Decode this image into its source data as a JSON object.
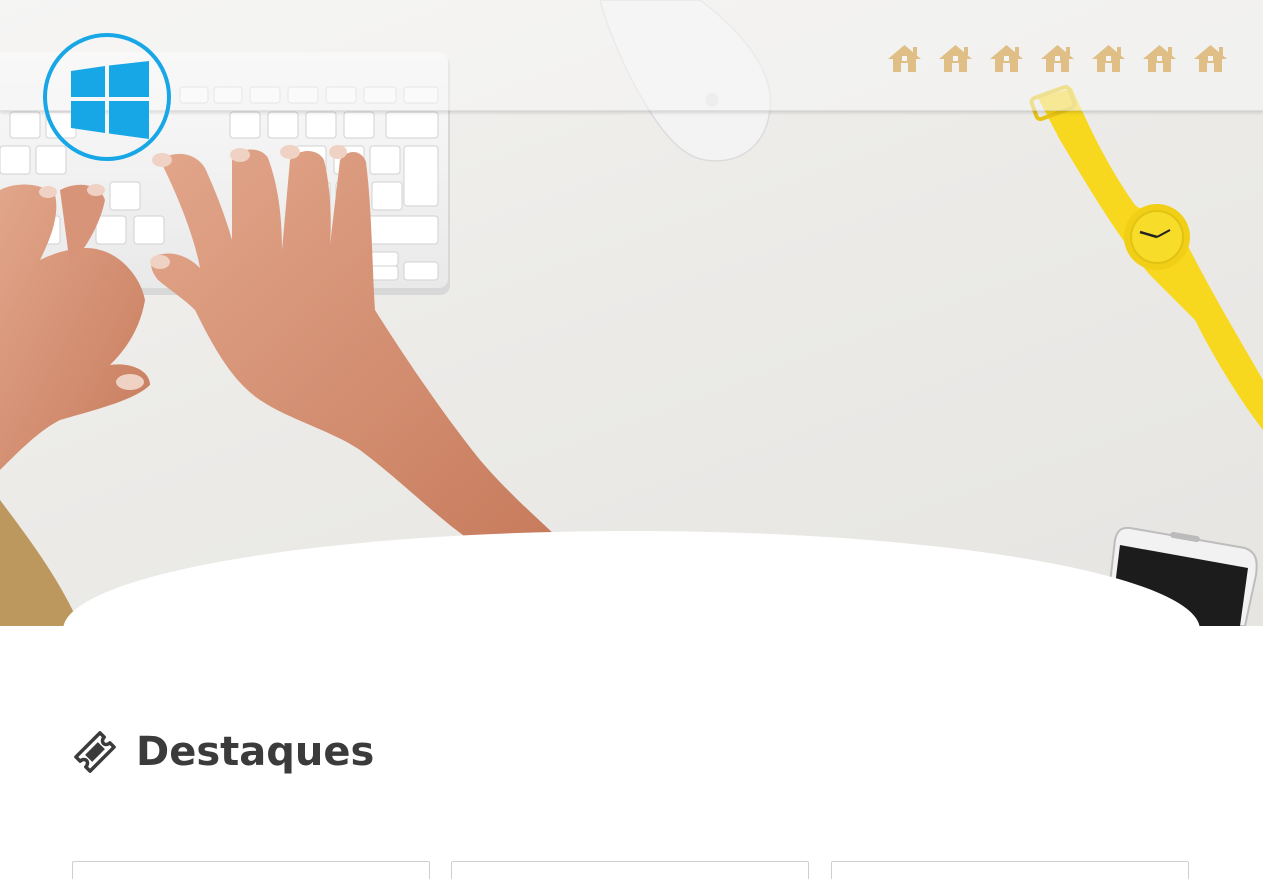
{
  "header": {
    "logo_icon": "windows-logo-icon",
    "accent_color": "#18a7e6",
    "nav_icon": "home-icon",
    "nav_icon_color": "#e0bf86",
    "nav_items": [
      "home",
      "home",
      "home",
      "home",
      "home",
      "home",
      "home"
    ]
  },
  "hero": {
    "image": "desk-typing-keyboard-photo"
  },
  "section": {
    "title": "Destaques",
    "icon": "ticket-icon"
  },
  "cards": [
    "card",
    "card",
    "card"
  ]
}
